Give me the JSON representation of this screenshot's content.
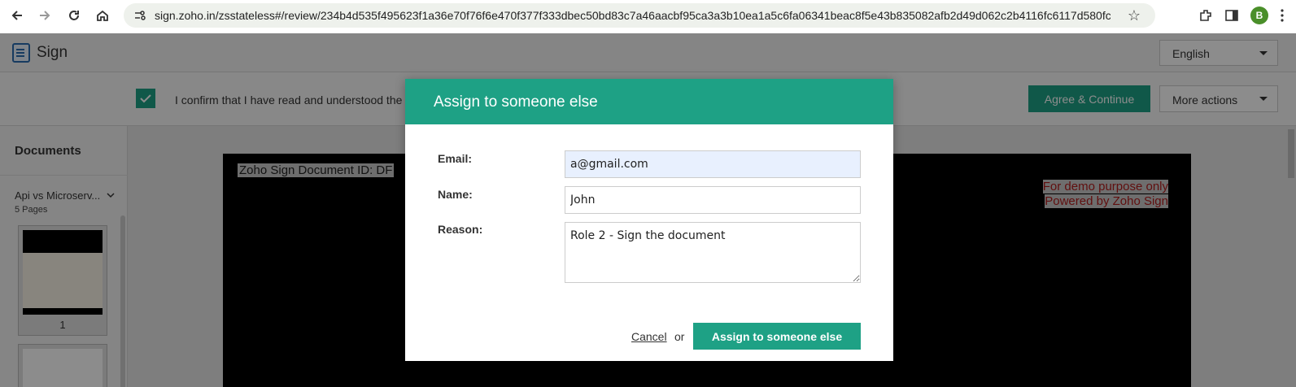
{
  "browser": {
    "url": "sign.zoho.in/zsstateless#/review/234b4d535f495623f1a36e70f76f6e470f377f333dbec50bd83c7a46aacbf95ca3a3b10ea1a5c6fa06341beac8f5e43b835082afb2d49d062c2b4116fc6117d580fcdf50...",
    "profile_initial": "B"
  },
  "app": {
    "title": "Sign",
    "language": "English",
    "confirm_text": "I confirm that I have read and understood the \"",
    "agree_label": "Agree & Continue",
    "more_actions_label": "More actions"
  },
  "sidebar": {
    "title": "Documents",
    "document_name": "Api vs Microserv...",
    "pages": "5 Pages",
    "thumb_page_number": "1"
  },
  "document": {
    "id_text": "Zoho Sign Document ID: DF",
    "watermark_line1": "For demo purpose only",
    "watermark_line2": "Powered by Zoho Sign"
  },
  "modal": {
    "title": "Assign to someone else",
    "email_label": "Email:",
    "email_value": "a@gmail.com",
    "name_label": "Name:",
    "name_value": "John",
    "reason_label": "Reason:",
    "reason_value": "Role 2 - Sign the document",
    "cancel_label": "Cancel",
    "or_text": "or",
    "submit_label": "Assign to someone else"
  }
}
